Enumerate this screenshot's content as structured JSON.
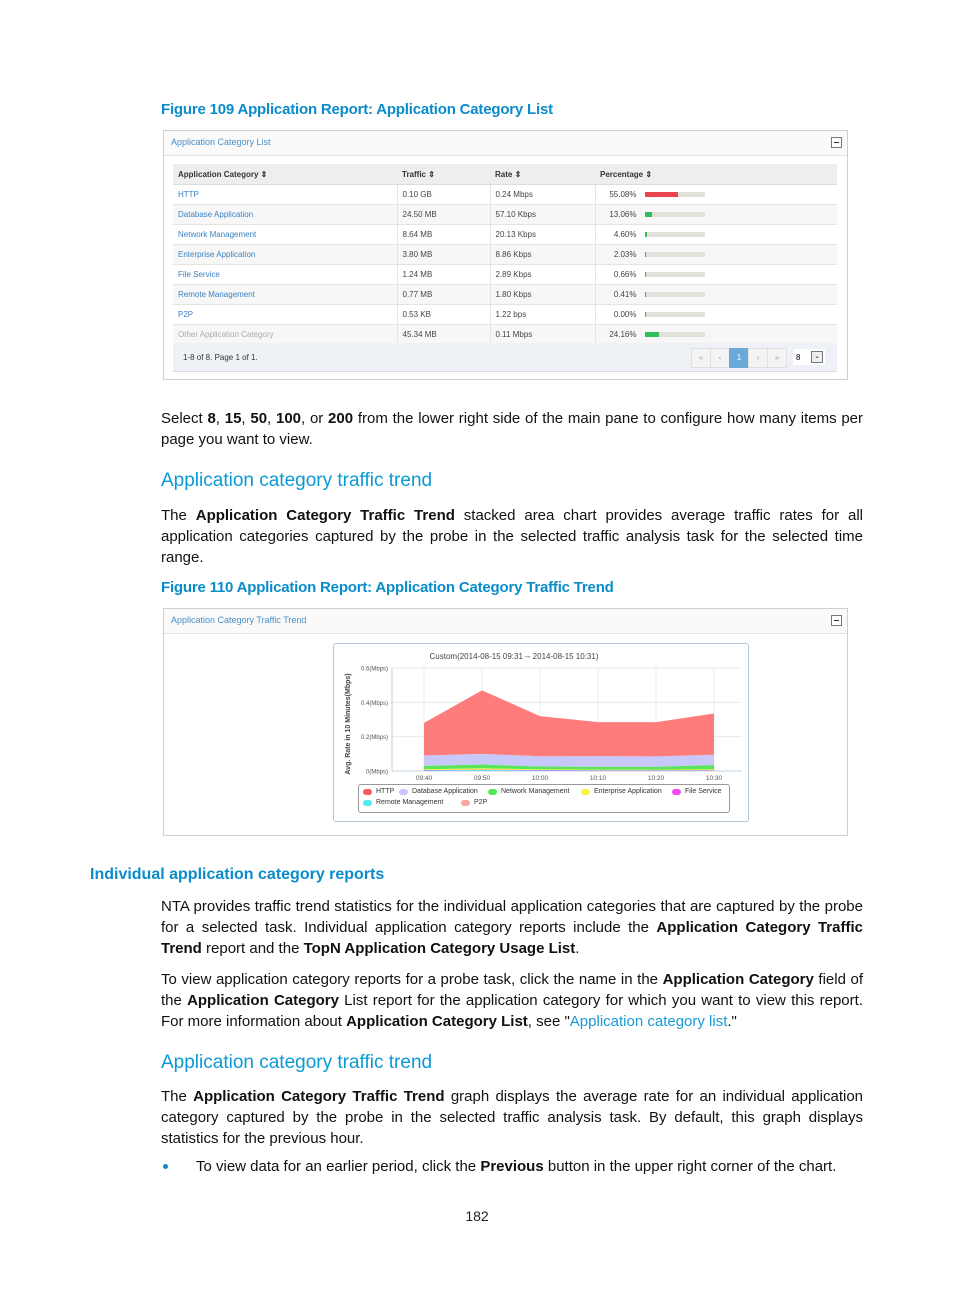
{
  "figure109": {
    "caption": "Figure 109 Application Report: Application Category List",
    "panel_title": "Application Category List",
    "columns": [
      "Application Category ⇕",
      "Traffic ⇕",
      "Rate ⇕",
      "Percentage ⇕"
    ],
    "rows": [
      {
        "category": "HTTP",
        "traffic": "0.10 GB",
        "rate": "0.24 Mbps",
        "percentage": "55.08%",
        "pct_value": 55.08,
        "bar_color": "#e8454e"
      },
      {
        "category": "Database Application",
        "traffic": "24.50 MB",
        "rate": "57.10 Kbps",
        "percentage": "13.06%",
        "pct_value": 13.06,
        "bar_color": "#2fbf5a"
      },
      {
        "category": "Network Management",
        "traffic": "8.64 MB",
        "rate": "20.13 Kbps",
        "percentage": "4.60%",
        "pct_value": 4.6,
        "bar_color": "#2fbf5a"
      },
      {
        "category": "Enterprise Application",
        "traffic": "3.80 MB",
        "rate": "8.86 Kbps",
        "percentage": "2.03%",
        "pct_value": 2.03,
        "bar_color": "#2fbf5a"
      },
      {
        "category": "File Service",
        "traffic": "1.24 MB",
        "rate": "2.89 Kbps",
        "percentage": "0.66%",
        "pct_value": 0.66,
        "bar_color": "#2fbf5a"
      },
      {
        "category": "Remote Management",
        "traffic": "0.77 MB",
        "rate": "1.80 Kbps",
        "percentage": "0.41%",
        "pct_value": 0.41,
        "bar_color": "#2fbf5a"
      },
      {
        "category": "P2P",
        "traffic": "0.53 KB",
        "rate": "1.22 bps",
        "percentage": "0.00%",
        "pct_value": 0.0,
        "bar_color": "#2fbf5a"
      },
      {
        "category": "Other Application Category",
        "traffic": "45.34 MB",
        "rate": "0.11 Mbps",
        "percentage": "24.16%",
        "pct_value": 24.16,
        "bar_color": "#2fbf5a"
      }
    ],
    "footer_info": "1-8 of 8. Page 1 of 1.",
    "pager": {
      "first": "«",
      "prev": "‹",
      "current": "1",
      "next": "›",
      "last": "»"
    },
    "page_size": "8",
    "page_size_icon": "chevron-down-icon"
  },
  "para_select": {
    "pre": "Select ",
    "b1": "8",
    "s1": ", ",
    "b2": "15",
    "s2": ", ",
    "b3": "50",
    "s3": ", ",
    "b4": "100",
    "s4": ", or ",
    "b5": "200",
    "post": " from the lower right side of the main pane to configure how many items per page you want to view."
  },
  "heading_trend_1": "Application category traffic trend",
  "para_trend_1": {
    "pre": "The ",
    "bold": "Application Category Traffic Trend",
    "post": " stacked area chart provides average traffic rates for all application categories captured by the probe in the selected traffic analysis task for the selected time range."
  },
  "figure110": {
    "caption": "Figure 110 Application Report: Application Category Traffic Trend",
    "panel_title": "Application Category Traffic Trend"
  },
  "chart_data": {
    "type": "area",
    "stacked": true,
    "title": "Custom(2014-08-15 09:31 -- 2014-08-15 10:31)",
    "xlabel": "",
    "ylabel": "Avg. Rate in 10 Minutes(Mbps)",
    "categories": [
      "09:40",
      "09:50",
      "10:00",
      "10:10",
      "10:20",
      "10:30"
    ],
    "y_ticks": [
      "0(Mbps)",
      "0.2(Mbps)",
      "0.4(Mbps)",
      "0.6(Mbps)"
    ],
    "y_tick_values": [
      0,
      0.2,
      0.4,
      0.6
    ],
    "ylim": [
      0,
      0.6
    ],
    "grid": true,
    "legend_position": "bottom",
    "series": [
      {
        "name": "Remote Management",
        "color": "#55e9f0",
        "values": [
          0.003,
          0.006,
          0.003,
          0.002,
          0.002,
          0.002
        ]
      },
      {
        "name": "File Service",
        "color": "#f04cf0",
        "values": [
          0.003,
          0.002,
          0.003,
          0.003,
          0.003,
          0.003
        ]
      },
      {
        "name": "Enterprise Application",
        "color": "#f5f542",
        "values": [
          0.004,
          0.008,
          0.004,
          0.003,
          0.003,
          0.005
        ]
      },
      {
        "name": "P2P",
        "color": "#f7a8a0",
        "values": [
          0.0,
          0.0,
          0.0,
          0.0,
          0.0,
          0.0
        ]
      },
      {
        "name": "Network Management",
        "color": "#5ae65a",
        "values": [
          0.02,
          0.022,
          0.016,
          0.017,
          0.017,
          0.025
        ]
      },
      {
        "name": "Database Application",
        "color": "#c8c8fa",
        "values": [
          0.06,
          0.062,
          0.06,
          0.062,
          0.06,
          0.06
        ]
      },
      {
        "name": "HTTP",
        "color": "#ff7c7c",
        "values": [
          0.19,
          0.37,
          0.234,
          0.198,
          0.2,
          0.24
        ]
      }
    ],
    "legend": [
      {
        "name": "HTTP",
        "color": "#ff5a5a"
      },
      {
        "name": "Database Application",
        "color": "#c8c8fa"
      },
      {
        "name": "Network Management",
        "color": "#5ae65a"
      },
      {
        "name": "Enterprise Application",
        "color": "#f5f542"
      },
      {
        "name": "File Service",
        "color": "#f04cf0"
      },
      {
        "name": "Remote Management",
        "color": "#55e9f0"
      },
      {
        "name": "P2P",
        "color": "#f7a8a0"
      }
    ]
  },
  "heading_individual": "Individual application category reports",
  "para_nta": {
    "pre": "NTA provides traffic trend statistics for the individual application categories that are captured by the probe for a selected task. Individual application category reports include the ",
    "b1": "Application Category Traffic Trend",
    "mid": " report and the ",
    "b2": "TopN Application Category Usage List",
    "post": "."
  },
  "para_view": {
    "t1": "To view application category reports for a probe task, click the name in the ",
    "b1": "Application Category",
    "t2": " field of the ",
    "b2": "Application Category",
    "t3": " List report for the application category for which you want to view this report. For more information about ",
    "b3": "Application Category List",
    "t4": ", see \"",
    "link": "Application category list",
    "t5": ".\""
  },
  "heading_trend_2": "Application category traffic trend",
  "para_trend_2": {
    "pre": "The ",
    "bold": "Application Category Traffic Trend",
    "post": " graph displays the average rate for an individual application category captured by the probe in the selected traffic analysis task. By default, this graph displays statistics for the previous hour."
  },
  "bullet_1": {
    "pre": "To view data for an earlier period, click the ",
    "bold": "Previous",
    "post": " button in the upper right corner of the chart."
  },
  "page_number": "182"
}
